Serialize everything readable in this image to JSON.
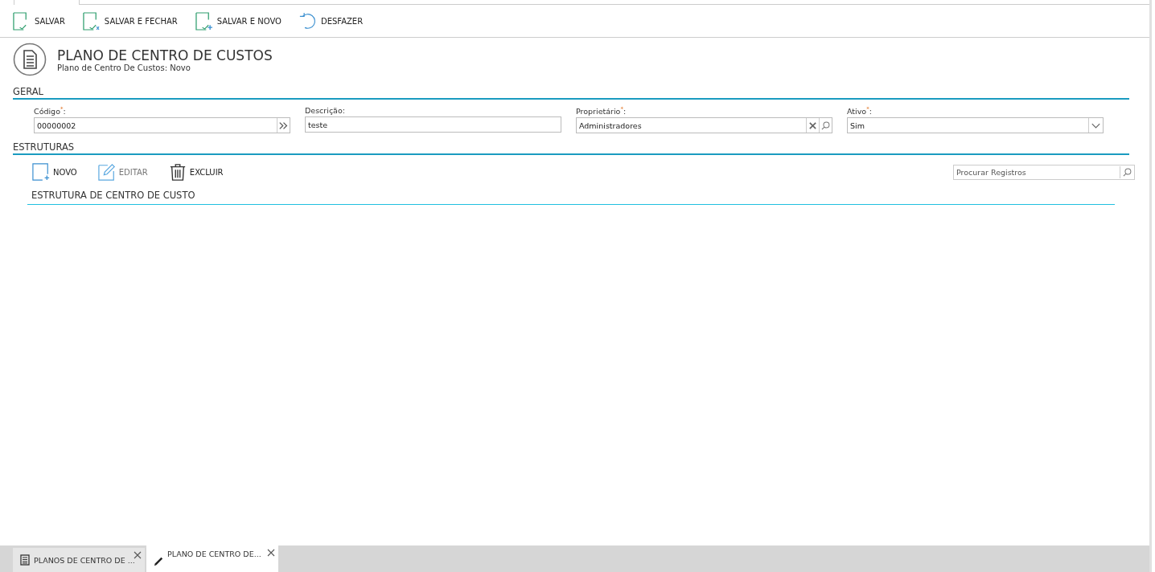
{
  "toolbar": [
    {
      "label": "SALVAR",
      "kind": "save"
    },
    {
      "label": "SALVAR E FECHAR",
      "kind": "save-close"
    },
    {
      "label": "SALVAR E NOVO",
      "kind": "save-new"
    },
    {
      "label": "DESFAZER",
      "kind": "undo"
    }
  ],
  "header": {
    "title": "PLANO DE CENTRO DE CUSTOS",
    "subtitle": "Plano de Centro De Custos: Novo"
  },
  "sections": {
    "general": "GERAL",
    "structures": "ESTRUTURAS"
  },
  "fields": [
    {
      "label": "Código$^{*}$:",
      "value": "00000002",
      "kind": "code"
    },
    {
      "label": "Descrição:",
      "value": "teste",
      "kind": "text"
    },
    {
      "label": "Proprietário$^{*}$:",
      "value": "Administradores",
      "kind": "lookup"
    },
    {
      "label": "Ativo$^{*}$:",
      "value": "Sim",
      "kind": "select"
    }
  ],
  "structure_actions": [
    {
      "label": "NOVO",
      "kind": "new",
      "disabled": false
    },
    {
      "label": "EDITAR",
      "kind": "edit",
      "disabled": true
    },
    {
      "label": "EXCLUIR",
      "kind": "delete",
      "disabled": false
    }
  ],
  "search": {
    "placeholder": "Procurar Registros"
  },
  "grid_title": "ESTRUTURA DE CENTRO DE CUSTO",
  "tabs": [
    {
      "label": "PLANOS DE CENTRO DE ...",
      "kind": "list",
      "selected": false
    },
    {
      "label": "PLANO DE CENTRO DE...",
      "kind": "edit",
      "selected": true
    }
  ]
}
